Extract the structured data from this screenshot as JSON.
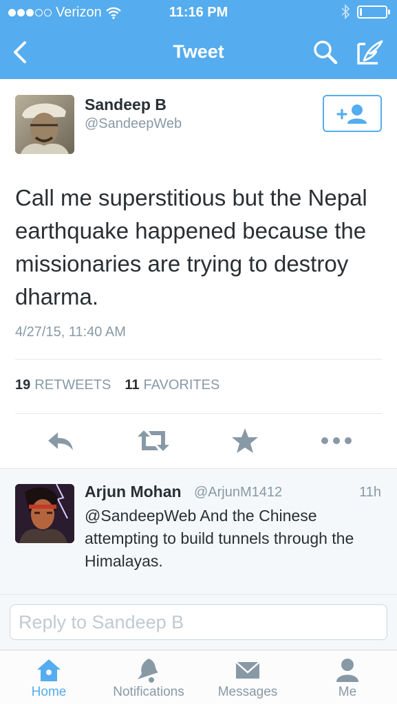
{
  "status_bar": {
    "carrier": "Verizon",
    "time": "11:16 PM",
    "signal_bars_filled": 3,
    "signal_bars_total": 5,
    "battery_level": 0.08
  },
  "nav": {
    "title": "Tweet",
    "back_icon": "chevron-left-icon",
    "search_icon": "search-icon",
    "compose_icon": "compose-icon"
  },
  "tweet": {
    "author_name": "Sandeep B",
    "author_handle": "@SandeepWeb",
    "text": "Call me superstitious but the Nepal earthquake happened because the missionaries are trying to destroy dharma.",
    "timestamp": "4/27/15, 11:40 AM",
    "retweets_count": "19",
    "retweets_label": "RETWEETS",
    "favorites_count": "11",
    "favorites_label": "FAVORITES"
  },
  "reply": {
    "author_name": "Arjun Mohan",
    "author_handle": "@ArjunM1412",
    "time": "11h",
    "text": "@SandeepWeb And the Chinese attempting to build tunnels through the Himalayas."
  },
  "compose": {
    "placeholder": "Reply to Sandeep B"
  },
  "tabs": [
    {
      "label": "Home",
      "icon": "home-icon",
      "active": true
    },
    {
      "label": "Notifications",
      "icon": "bell-icon",
      "active": false
    },
    {
      "label": "Messages",
      "icon": "envelope-icon",
      "active": false
    },
    {
      "label": "Me",
      "icon": "person-icon",
      "active": false
    }
  ],
  "colors": {
    "brand_blue": "#55acee",
    "text_dark": "#292f33",
    "text_gray": "#8899a6",
    "icon_gray": "#8899a6"
  }
}
